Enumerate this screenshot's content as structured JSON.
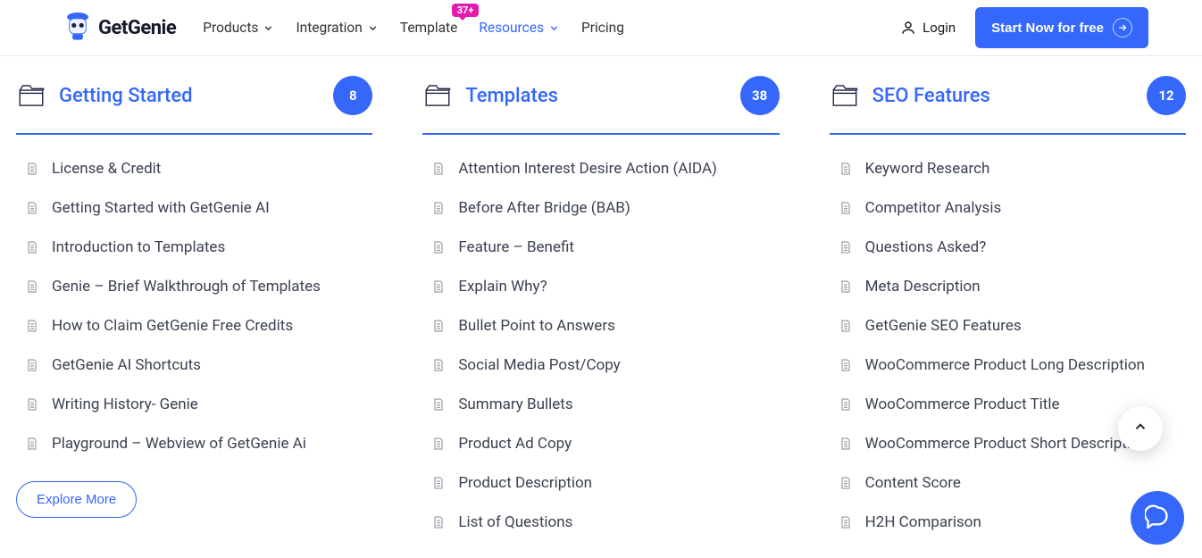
{
  "header": {
    "logo_text": "GetGenie",
    "nav": {
      "products": "Products",
      "integration": "Integration",
      "template": "Template",
      "template_badge": "37+",
      "resources": "Resources",
      "pricing": "Pricing"
    },
    "login": "Login",
    "cta": "Start Now for free"
  },
  "columns": [
    {
      "title": "Getting Started",
      "count": "8",
      "items": [
        "License & Credit",
        "Getting Started with GetGenie AI",
        "Introduction to Templates",
        "Genie – Brief Walkthrough of Templates",
        "How to Claim GetGenie Free Credits",
        "GetGenie AI Shortcuts",
        "Writing History- Genie",
        "Playground – Webview of GetGenie Ai"
      ],
      "explore": "Explore More"
    },
    {
      "title": "Templates",
      "count": "38",
      "items": [
        "Attention Interest Desire Action (AIDA)",
        "Before After Bridge (BAB)",
        "Feature – Benefit",
        "Explain Why?",
        "Bullet Point to Answers",
        "Social Media Post/Copy",
        "Summary Bullets",
        "Product Ad Copy",
        "Product Description",
        "List of Questions"
      ]
    },
    {
      "title": "SEO Features",
      "count": "12",
      "items": [
        "Keyword Research",
        "Competitor Analysis",
        "Questions Asked?",
        "Meta Description",
        "GetGenie SEO Features",
        "WooCommerce Product Long Description",
        "WooCommerce Product Title",
        "WooCommerce Product Short Description",
        "Content Score",
        "H2H Comparison"
      ]
    }
  ]
}
